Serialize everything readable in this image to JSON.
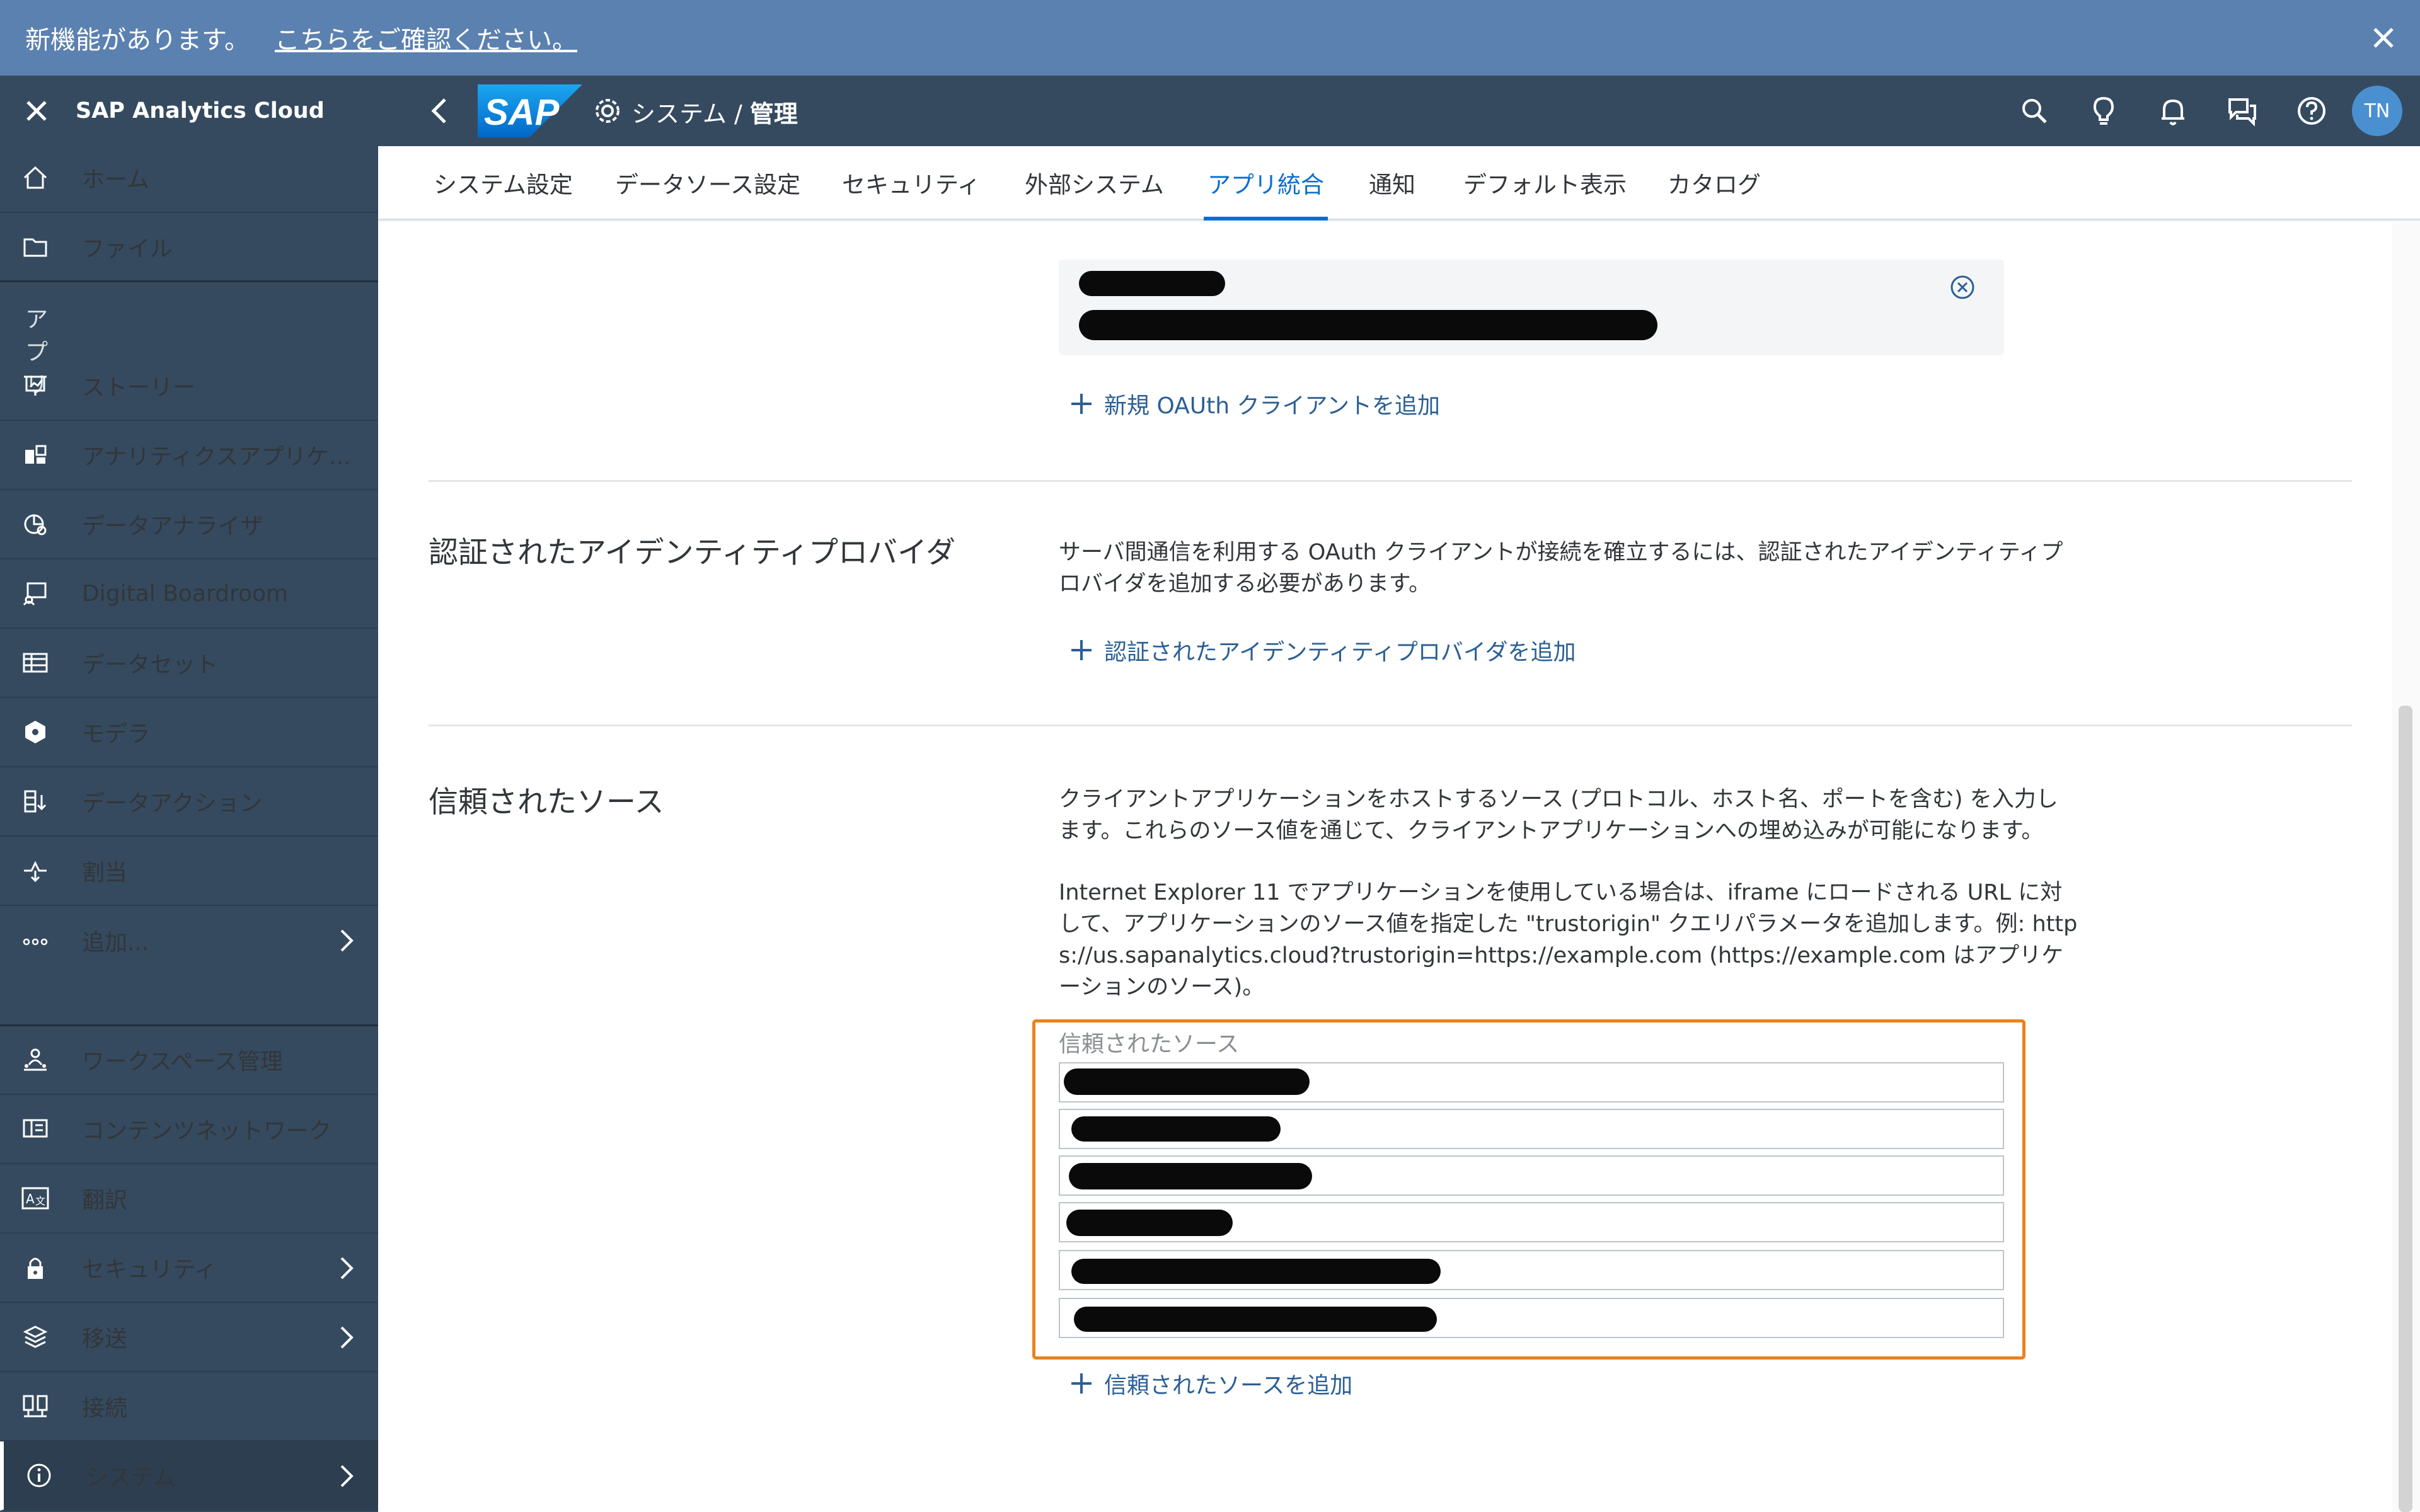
{
  "banner": {
    "message": "新機能があります。",
    "link": "こちらをご確認ください。"
  },
  "sidebar": {
    "brand": "SAP Analytics Cloud",
    "section_apps": "アプリ",
    "items": [
      {
        "label": "ホーム",
        "icon": "home-icon"
      },
      {
        "label": "ファイル",
        "icon": "folder-icon"
      },
      {
        "label": "ストーリー",
        "icon": "story-icon"
      },
      {
        "label": "アナリティクスアプリケ...",
        "icon": "analytic-app-icon"
      },
      {
        "label": "データアナライザ",
        "icon": "data-analyzer-icon"
      },
      {
        "label": "Digital Boardroom",
        "icon": "boardroom-icon"
      },
      {
        "label": "データセット",
        "icon": "dataset-icon"
      },
      {
        "label": "モデラ",
        "icon": "modeler-icon"
      },
      {
        "label": "データアクション",
        "icon": "data-action-icon"
      },
      {
        "label": "割当",
        "icon": "allocation-icon"
      },
      {
        "label": "追加...",
        "icon": "more-icon"
      },
      {
        "label": "ワークスペース管理",
        "icon": "workspace-icon"
      },
      {
        "label": "コンテンツネットワーク",
        "icon": "content-network-icon"
      },
      {
        "label": "翻訳",
        "icon": "translation-icon"
      },
      {
        "label": "セキュリティ",
        "icon": "lock-icon"
      },
      {
        "label": "移送",
        "icon": "transport-icon"
      },
      {
        "label": "接続",
        "icon": "connection-icon"
      },
      {
        "label": "システム",
        "icon": "info-icon"
      }
    ]
  },
  "header": {
    "logo_text": "SAP",
    "crumb_prefix": "システム / ",
    "crumb_current": "管理",
    "avatar": "TN"
  },
  "tabs": [
    "システム設定",
    "データソース設定",
    "セキュリティ",
    "外部システム",
    "アプリ統合",
    "通知",
    "デフォルト表示",
    "カタログ"
  ],
  "active_tab": "アプリ統合",
  "oauth": {
    "add_label": "新規 OAUth クライアントを追加"
  },
  "idp": {
    "title": "認証されたアイデンティティプロバイダ",
    "desc": "サーバ間通信を利用する OAuth クライアントが接続を確立するには、認証されたアイデンティティプロバイダを追加する必要があります。",
    "add_label": "認証されたアイデンティティプロバイダを追加"
  },
  "trusted": {
    "title": "信頼されたソース",
    "desc1": "クライアントアプリケーションをホストするソース (プロトコル、ホスト名、ポートを含む) を入力します。これらのソース値を通じて、クライアントアプリケーションへの埋め込みが可能になります。",
    "desc2": "Internet Explorer 11 でアプリケーションを使用している場合は、iframe にロードされる URL に対して、アプリケーションのソース値を指定した \"trustorigin\" クエリパラメータを追加します。例: https://us.sapanalytics.cloud?trustorigin=https://example.com (https://example.com はアプリケーションのソース)。",
    "field_label": "信頼されたソース",
    "add_label": "信頼されたソースを追加"
  },
  "colors": {
    "banner": "#5b81b0",
    "shell": "#354a5f",
    "accent": "#0a6ed1",
    "highlight": "#e9821d",
    "link": "#2b5f95"
  }
}
